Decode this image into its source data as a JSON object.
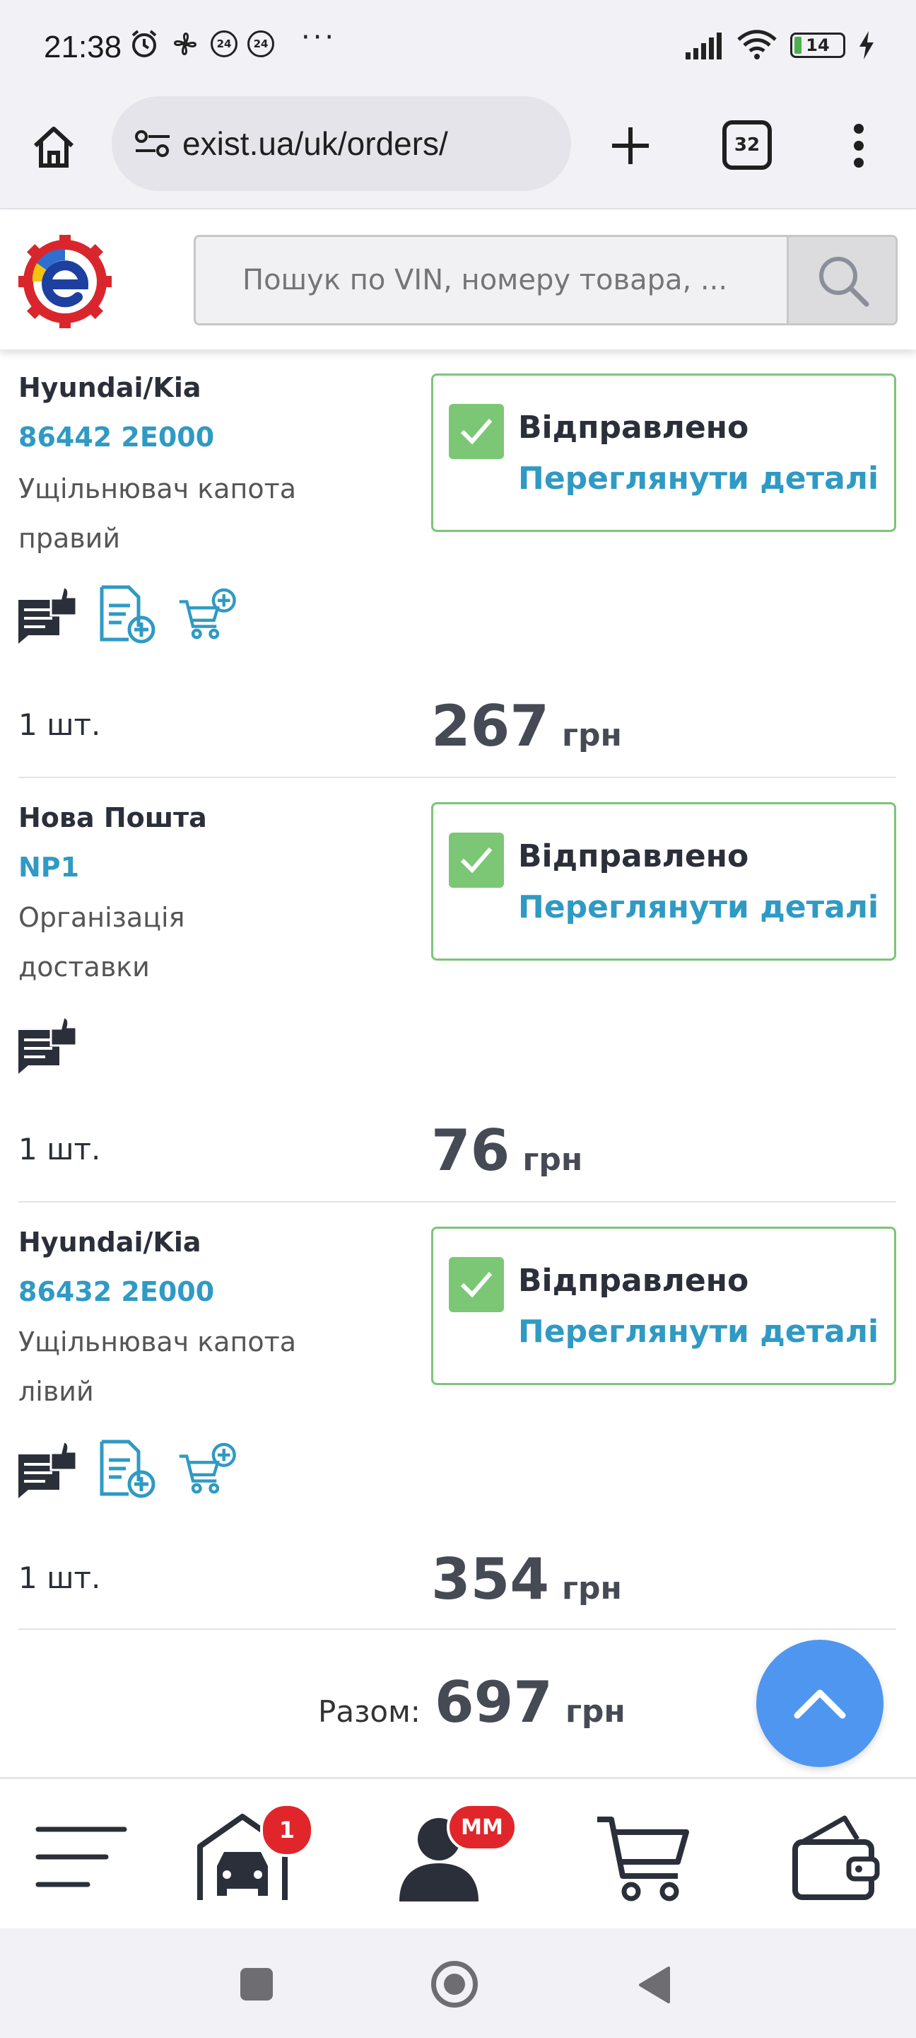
{
  "status_bar": {
    "time": "21:38",
    "badge_a": "24",
    "badge_b": "24",
    "more": "···",
    "battery": "14"
  },
  "browser": {
    "url": "exist.ua/uk/orders/",
    "tab_count": "32"
  },
  "site": {
    "search_placeholder": "Пошук по VIN, номеру товара, ..."
  },
  "orders": [
    {
      "brand": "Hyundai/Kia",
      "code": "86442 2E000",
      "desc_line1": "Ущільнювач капота",
      "desc_line2": "правий",
      "status": "Відправлено",
      "details": "Переглянути деталі",
      "qty": "1 шт.",
      "price": "267",
      "currency": "грн"
    },
    {
      "brand": "Нова Пошта",
      "code": "NP1",
      "desc_line1": "Організація",
      "desc_line2": "доставки",
      "status": "Відправлено",
      "details": "Переглянути деталі",
      "qty": "1 шт.",
      "price": "76",
      "currency": "грн"
    },
    {
      "brand": "Hyundai/Kia",
      "code": "86432 2E000",
      "desc_line1": "Ущільнювач капота",
      "desc_line2": "лівий",
      "status": "Відправлено",
      "details": "Переглянути деталі",
      "qty": "1 шт.",
      "price": "354",
      "currency": "грн"
    }
  ],
  "total": {
    "label": "Разом:",
    "value": "697",
    "currency": "грн"
  },
  "bottom_nav": {
    "garage_badge": "1",
    "profile_badge": "MM"
  },
  "colors": {
    "accent_blue": "#2f9ac4",
    "status_green": "#7cc775",
    "scroll_button": "#4f96f1",
    "badge_red": "#e0262b"
  }
}
